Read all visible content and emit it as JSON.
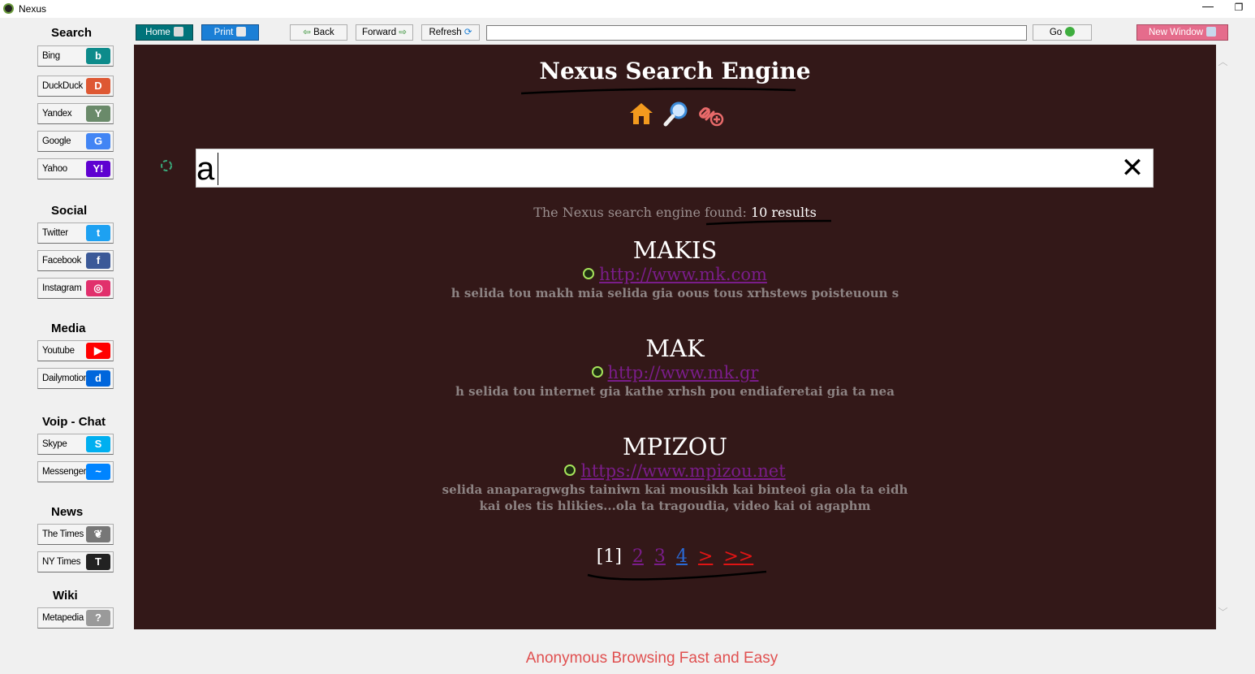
{
  "window": {
    "title": "Nexus",
    "min_glyph": "—",
    "restore_glyph": "❐"
  },
  "sidebar": {
    "categories": [
      {
        "title": "Search",
        "items": [
          {
            "label": "Bing",
            "icon": "bing-icon",
            "color": "#0d8b8b",
            "glyph": "b"
          },
          {
            "label": "DuckDuck",
            "icon": "duckduckgo-icon",
            "color": "#de5833",
            "glyph": "D"
          },
          {
            "label": "Yandex",
            "icon": "yandex-icon",
            "color": "#6a8a6a",
            "glyph": "Y"
          },
          {
            "label": "Google",
            "icon": "google-icon",
            "color": "#4285f4",
            "glyph": "G"
          },
          {
            "label": "Yahoo",
            "icon": "yahoo-icon",
            "color": "#5f01d1",
            "glyph": "Y!"
          }
        ]
      },
      {
        "title": "Social",
        "items": [
          {
            "label": "Twitter",
            "icon": "twitter-icon",
            "color": "#1da1f2",
            "glyph": "t"
          },
          {
            "label": "Facebook",
            "icon": "facebook-icon",
            "color": "#3b5998",
            "glyph": "f"
          },
          {
            "label": "Instagram",
            "icon": "instagram-icon",
            "color": "#e1306c",
            "glyph": "◎"
          }
        ]
      },
      {
        "title": "Media",
        "items": [
          {
            "label": "Youtube",
            "icon": "youtube-icon",
            "color": "#ff0000",
            "glyph": "▶"
          },
          {
            "label": "Dailymotion",
            "icon": "dailymotion-icon",
            "color": "#0066dc",
            "glyph": "d"
          }
        ]
      },
      {
        "title": "Voip - Chat",
        "items": [
          {
            "label": "Skype",
            "icon": "skype-icon",
            "color": "#00aff0",
            "glyph": "S"
          },
          {
            "label": "Messenger",
            "icon": "messenger-icon",
            "color": "#0084ff",
            "glyph": "~"
          }
        ]
      },
      {
        "title": "News",
        "items": [
          {
            "label": "The Times",
            "icon": "the-times-icon",
            "color": "#777777",
            "glyph": "❦"
          },
          {
            "label": "NY Times",
            "icon": "nytimes-icon",
            "color": "#222222",
            "glyph": "T"
          }
        ]
      },
      {
        "title": "Wiki",
        "items": [
          {
            "label": "Metapedia",
            "icon": "metapedia-icon",
            "color": "#9a9a9a",
            "glyph": "?"
          }
        ]
      }
    ]
  },
  "toolbar": {
    "home_label": "Home",
    "print_label": "Print",
    "back_label": "Back",
    "forward_label": "Forward",
    "refresh_label": "Refresh",
    "address_value": "",
    "go_label": "Go",
    "new_window_label": "New Window"
  },
  "page": {
    "title": "Nexus Search Engine",
    "search_value": "a",
    "clear_glyph": "✕",
    "found_prefix": "The Nexus search engine found:",
    "found_count": "10 results",
    "results": [
      {
        "title": "MAKIS",
        "url": "http://www.mk.com",
        "description": [
          "h selida tou makh mia selida gia oous tous xrhstews poisteuoun s"
        ]
      },
      {
        "title": "MAK",
        "url": "http://www.mk.gr",
        "description": [
          "h selida tou internet gia kathe xrhsh pou endiaferetai gia ta nea"
        ]
      },
      {
        "title": "MPIZOU",
        "url": "https://www.mpizou.net",
        "description": [
          "selida anaparagwghs tainiwn kai mousikh kai binteoi gia ola ta eidh",
          "kai oles tis hlikies...ola ta tragoudia, video kai oi agaphm"
        ]
      }
    ],
    "pager": {
      "current": "[1]",
      "pages": [
        "2",
        "3",
        "4"
      ],
      "next": ">",
      "last": ">>"
    }
  },
  "footer": {
    "text": "Anonymous Browsing Fast and Easy"
  },
  "colors": {
    "view_bg": "#331818",
    "footer_text": "#e05050",
    "link_visited": "#7a1d8a"
  }
}
